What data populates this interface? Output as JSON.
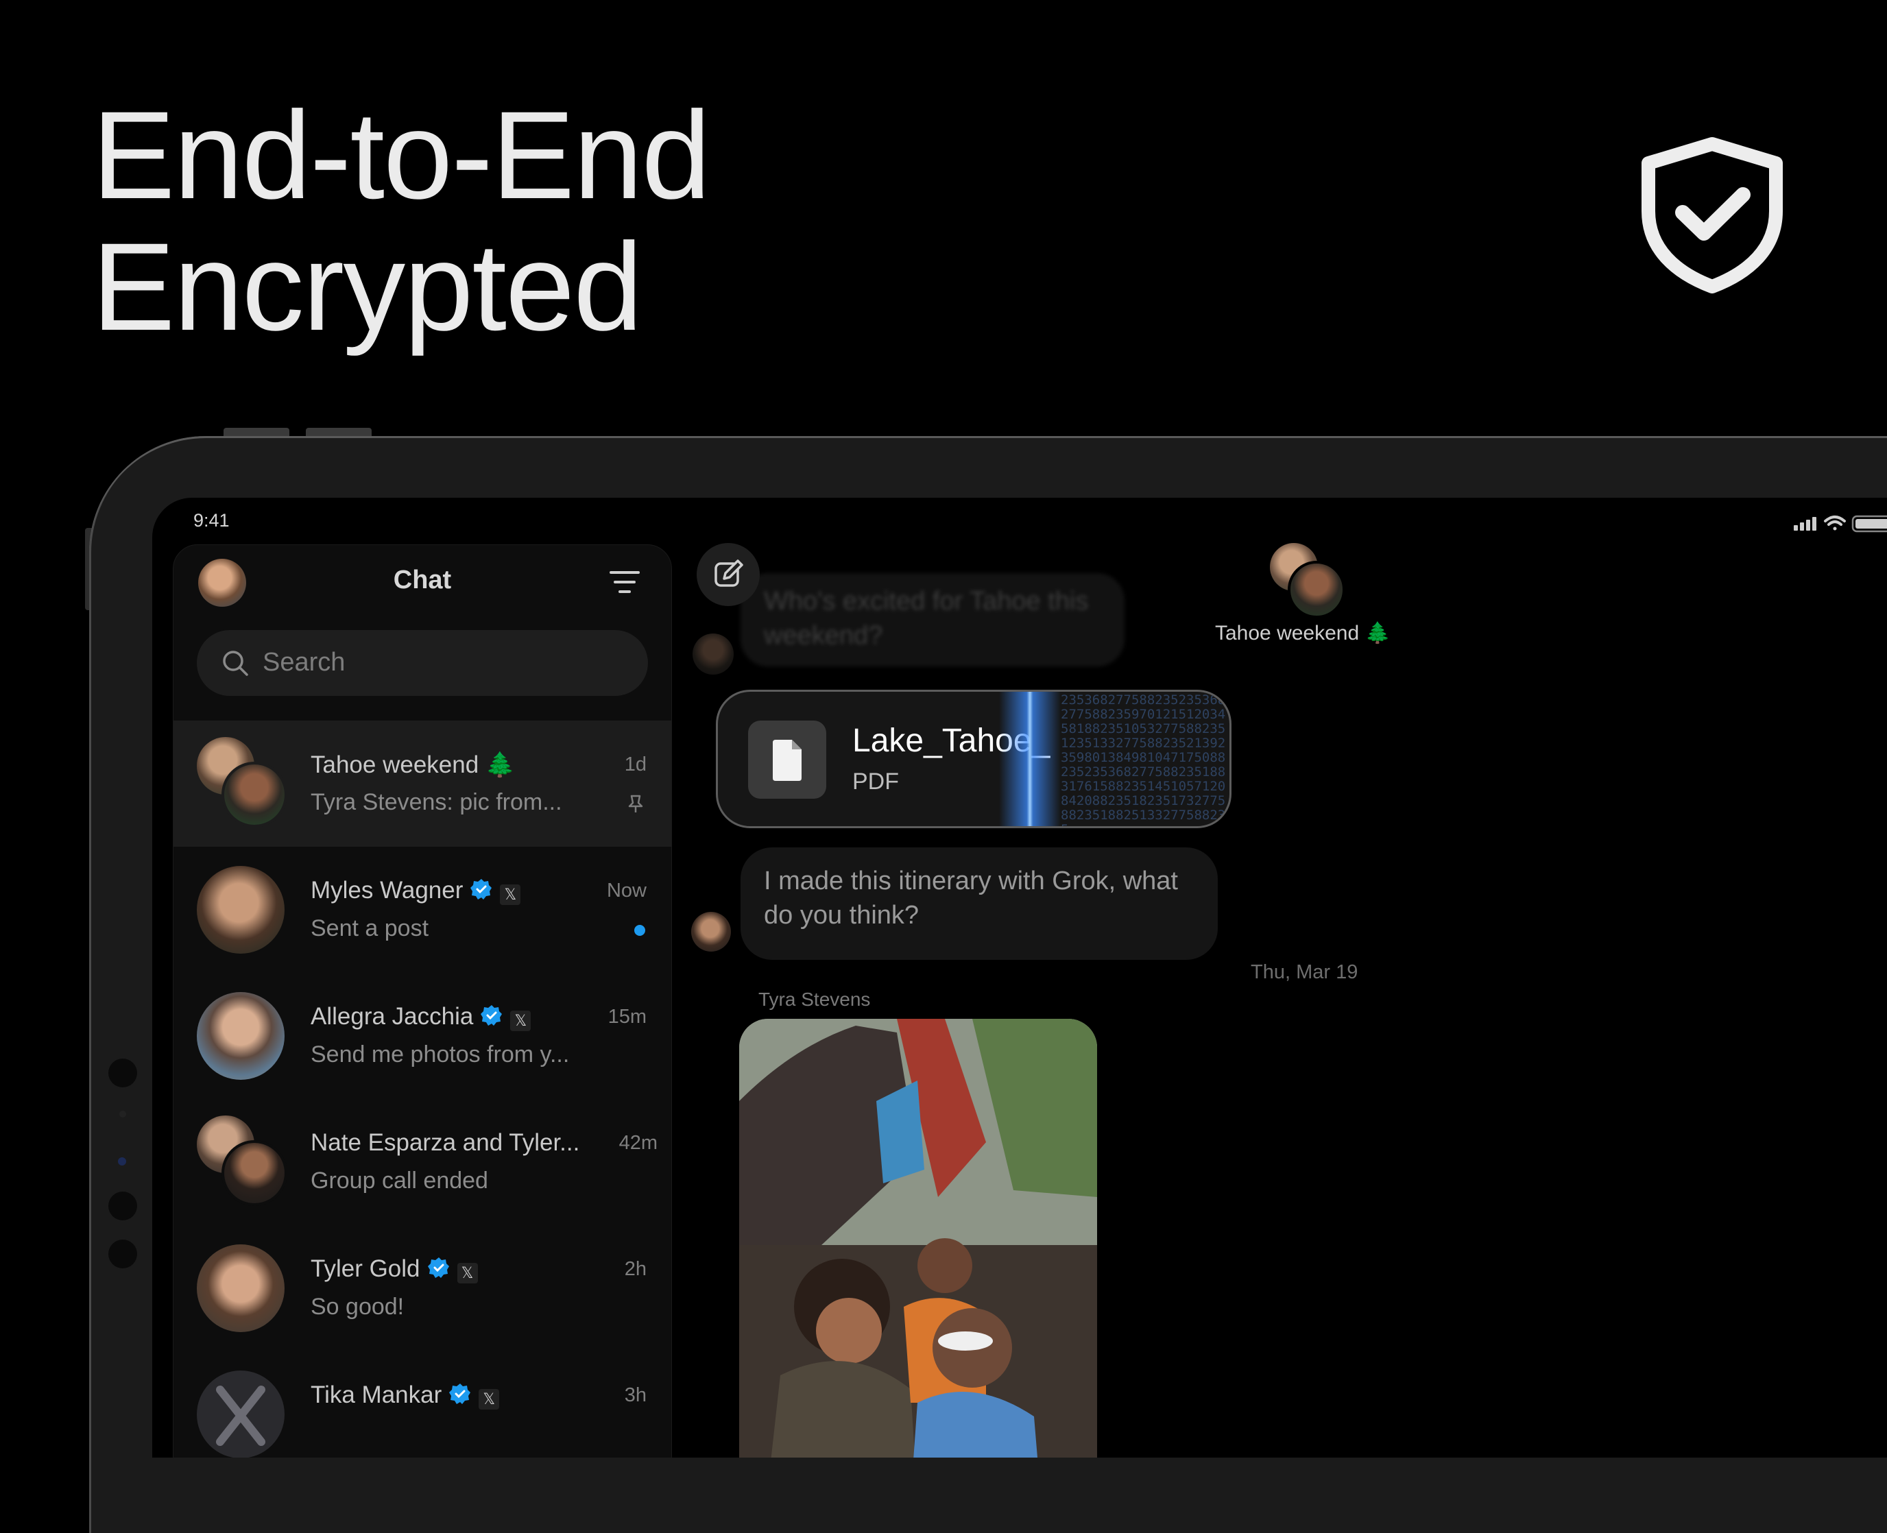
{
  "headline": {
    "line1": "End-to-End",
    "line2": "Encrypted"
  },
  "status_bar": {
    "time": "9:41"
  },
  "sidebar": {
    "title": "Chat",
    "search_placeholder": "Search",
    "chats": [
      {
        "name": "Tahoe weekend 🌲",
        "preview": "Tyra Stevens: pic from...",
        "time": "1d",
        "pinned": true,
        "verified": false,
        "x_badge": false
      },
      {
        "name": "Myles Wagner",
        "preview": "Sent a post",
        "time": "Now",
        "unread": true,
        "verified": true,
        "x_badge": true
      },
      {
        "name": "Allegra Jacchia",
        "preview": "Send me photos from y...",
        "time": "15m",
        "verified": true,
        "x_badge": true
      },
      {
        "name": "Nate Esparza and Tyler...",
        "preview": "Group call ended",
        "time": "42m",
        "verified": false,
        "x_badge": false
      },
      {
        "name": "Tyler Gold",
        "preview": "So good!",
        "time": "2h",
        "verified": true,
        "x_badge": true
      },
      {
        "name": "Tika Mankar",
        "preview": "",
        "time": "3h",
        "verified": true,
        "x_badge": true
      }
    ]
  },
  "conversation": {
    "group_name": "Tahoe weekend 🌲",
    "faded_message": "Who's excited for Tahoe this weekend?",
    "file": {
      "name": "Lake_Tahoe_",
      "type": "PDF",
      "cipher": "2353682775882352353682775882359701215120345818823510532775882351235133277588235213923598013849810471750882352353682775882351883176158823514510571208420882351823517327758823518825133277588235"
    },
    "message": "I made this itinerary with Grok, what do you think?",
    "date": "Thu, Mar 19",
    "sender": "Tyra Stevens"
  },
  "colors": {
    "background": "#000000",
    "verified": "#1d9bf0",
    "scan": "#6aaeff"
  },
  "icons": [
    "shield-check-icon",
    "filter-icon",
    "search-icon",
    "compose-icon",
    "file-icon",
    "pin-icon",
    "verified-icon",
    "x-logo-icon",
    "signal-icon",
    "wifi-icon",
    "battery-icon"
  ]
}
